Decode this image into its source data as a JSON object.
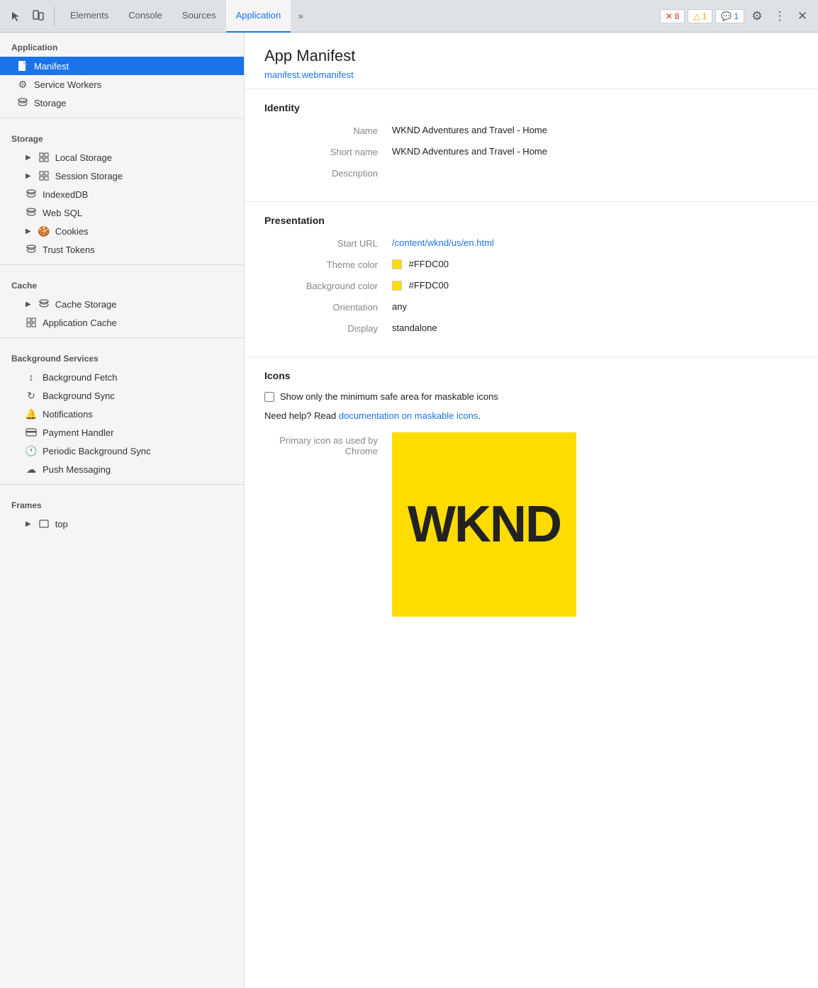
{
  "toolbar": {
    "tabs": [
      {
        "label": "Elements",
        "active": false
      },
      {
        "label": "Console",
        "active": false
      },
      {
        "label": "Sources",
        "active": false
      },
      {
        "label": "Application",
        "active": true
      },
      {
        "label": "»",
        "active": false
      }
    ],
    "badges": {
      "errors": {
        "count": "8",
        "icon": "✕"
      },
      "warnings": {
        "count": "1",
        "icon": "△"
      },
      "messages": {
        "count": "1",
        "icon": "💬"
      }
    },
    "close_label": "✕"
  },
  "sidebar": {
    "application_section": "Application",
    "application_items": [
      {
        "label": "Manifest",
        "active": true,
        "icon": "doc"
      },
      {
        "label": "Service Workers",
        "icon": "gear"
      },
      {
        "label": "Storage",
        "icon": "db"
      }
    ],
    "storage_section": "Storage",
    "storage_items": [
      {
        "label": "Local Storage",
        "icon": "grid",
        "has_arrow": true
      },
      {
        "label": "Session Storage",
        "icon": "grid",
        "has_arrow": true
      },
      {
        "label": "IndexedDB",
        "icon": "db"
      },
      {
        "label": "Web SQL",
        "icon": "db"
      },
      {
        "label": "Cookies",
        "icon": "cookie",
        "has_arrow": true
      },
      {
        "label": "Trust Tokens",
        "icon": "db"
      }
    ],
    "cache_section": "Cache",
    "cache_items": [
      {
        "label": "Cache Storage",
        "icon": "db",
        "has_arrow": true
      },
      {
        "label": "Application Cache",
        "icon": "grid"
      }
    ],
    "bg_section": "Background Services",
    "bg_items": [
      {
        "label": "Background Fetch",
        "icon": "arrows"
      },
      {
        "label": "Background Sync",
        "icon": "sync"
      },
      {
        "label": "Notifications",
        "icon": "bell"
      },
      {
        "label": "Payment Handler",
        "icon": "card"
      },
      {
        "label": "Periodic Background Sync",
        "icon": "clock"
      },
      {
        "label": "Push Messaging",
        "icon": "cloud"
      }
    ],
    "frames_section": "Frames",
    "frames_items": [
      {
        "label": "top",
        "icon": "window",
        "has_arrow": true
      }
    ]
  },
  "content": {
    "title": "App Manifest",
    "manifest_link": "manifest.webmanifest",
    "identity": {
      "section_title": "Identity",
      "name_label": "Name",
      "name_value": "WKND Adventures and Travel - Home",
      "short_name_label": "Short name",
      "short_name_value": "WKND Adventures and Travel - Home",
      "description_label": "Description",
      "description_value": ""
    },
    "presentation": {
      "section_title": "Presentation",
      "start_url_label": "Start URL",
      "start_url_value": "/content/wknd/us/en.html",
      "theme_color_label": "Theme color",
      "theme_color_value": "#FFDC00",
      "theme_color_swatch": "#FFDC00",
      "bg_color_label": "Background color",
      "bg_color_value": "#FFDC00",
      "bg_color_swatch": "#FFDC00",
      "orientation_label": "Orientation",
      "orientation_value": "any",
      "display_label": "Display",
      "display_value": "standalone"
    },
    "icons": {
      "section_title": "Icons",
      "checkbox_label": "Show only the minimum safe area for maskable icons",
      "help_text_prefix": "Need help? Read ",
      "help_link_text": "documentation on maskable icons",
      "help_text_suffix": ".",
      "primary_icon_label": "Primary icon as used by",
      "chrome_label": "Chrome",
      "icon_text": "WKND",
      "icon_bg_color": "#FFDC00"
    }
  }
}
